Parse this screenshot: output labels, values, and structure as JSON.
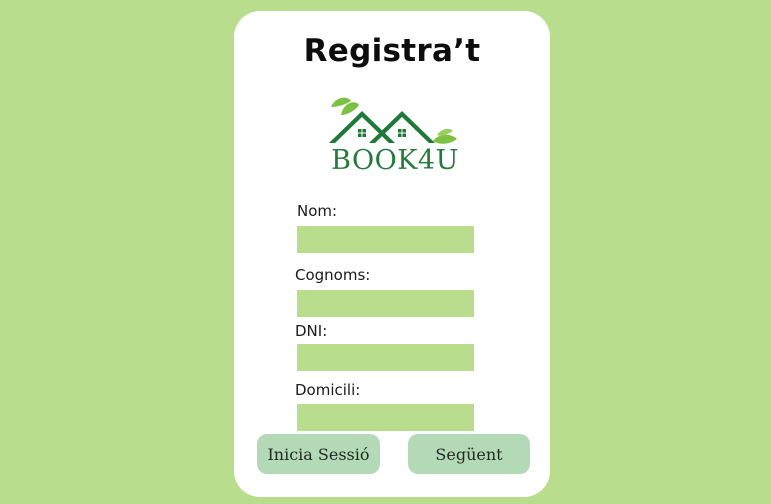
{
  "page": {
    "title": "Registra’t"
  },
  "logo": {
    "brand": "BOOK4U",
    "icon": "houses-with-leaves-logo"
  },
  "form": {
    "fields": [
      {
        "label": "Nom:",
        "value": ""
      },
      {
        "label": "Cognoms:",
        "value": ""
      },
      {
        "label": "DNI:",
        "value": ""
      },
      {
        "label": "Domicili:",
        "value": ""
      }
    ]
  },
  "buttons": {
    "login": "Inicia Sessió",
    "next": "Següent"
  },
  "colors": {
    "background": "#b8dd8c",
    "card": "#ffffff",
    "brand": "#237a3b",
    "button": "#b4d9b7"
  }
}
